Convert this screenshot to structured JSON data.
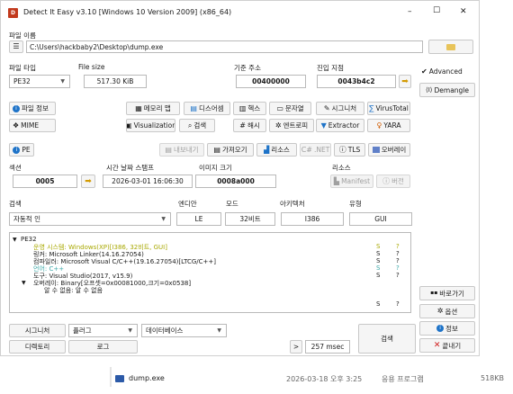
{
  "window": {
    "title": "Detect It Easy v3.10 [Windows 10 Version 2009] (x86_64)",
    "min": "–",
    "max": "☐",
    "close": "✕"
  },
  "file": {
    "label": "파일 이름",
    "path": "C:\\Users\\hackbaby2\\Desktop\\dump.exe"
  },
  "filetype": {
    "label": "파일 타입",
    "value": "PE32"
  },
  "filesize": {
    "label": "File size",
    "value": "517.30 KiB"
  },
  "base": {
    "label": "기준 주소",
    "value": "00400000"
  },
  "entry": {
    "label": "진입 지점",
    "value": "0043b4c2"
  },
  "right_panel": {
    "advanced": "Advanced",
    "demangle": "Demangle",
    "goto": "바로가기",
    "options": "옵션",
    "about": "정보",
    "exit": "끝내기"
  },
  "tools_row1": [
    "파일 정보",
    "메모리 맵",
    "디스어셈",
    "헥스",
    "문자열",
    "시그니처",
    "VirusTotal"
  ],
  "tools_row2": [
    "MIME",
    "Visualization",
    "검색",
    "해시",
    "엔트로피",
    "Extractor",
    "YARA"
  ],
  "pe_row": {
    "pe": "PE",
    "export": "내보내기",
    "import": "가져오기",
    "resource": "리소스",
    "net": ".NET",
    "tls": "TLS",
    "overlay": "오버레이"
  },
  "section": {
    "label": "섹션",
    "value": "0005"
  },
  "timestamp": {
    "label": "시간 날짜 스탬프",
    "value": "2026-03-01 16:06:30"
  },
  "image_size": {
    "label": "이미지 크기",
    "value": "0008a000"
  },
  "resources": {
    "label": "리소스",
    "manifest": "Manifest",
    "version": "버전"
  },
  "scan": {
    "label": "검색",
    "mode_value": "자동적 인",
    "endian_label": "엔디안",
    "endian": "LE",
    "mode_label": "모드",
    "mode": "32비트",
    "arch_label": "아키텍처",
    "arch": "I386",
    "type_label": "유형",
    "type": "GUI"
  },
  "results": {
    "root": "PE32",
    "lines": [
      {
        "text": "운영 시스템: Windows(XP)[I386, 32비트, GUI]",
        "color": "#a8a800",
        "s": "S",
        "q": "?"
      },
      {
        "text": "링커: Microsoft Linker(14.16.27054)",
        "color": "#1a1a1a",
        "s": "S",
        "q": "?"
      },
      {
        "text": "컴파일러: Microsoft Visual C/C++(19.16.27054)[LTCG/C++]",
        "color": "#1a1a1a",
        "s": "S",
        "q": "?"
      },
      {
        "text": "언어: C++",
        "color": "#3da9a9",
        "s": "S",
        "q": "?"
      },
      {
        "text": "도구: Visual Studio(2017, v15.9)",
        "color": "#1a1a1a",
        "s": "S",
        "q": "?"
      }
    ],
    "overlay": "오버레이: Binary[오프셋=0x00081000,크기=0x0538]",
    "overlay_child": "알 수 없음: 알 수 없음",
    "overlay_s": "S",
    "overlay_q": "?"
  },
  "bottom": {
    "signatures": "시그니처",
    "plugin": "플러그",
    "database": "데이터베이스",
    "directory": "디렉토리",
    "log": "로그",
    "more": ">",
    "time": "257 msec",
    "scan_button": "검색"
  },
  "explorer_row": {
    "name": "dump.exe",
    "date": "2026-03-18 오후 3:25",
    "type": "응용 프로그램",
    "size": "518KB"
  }
}
